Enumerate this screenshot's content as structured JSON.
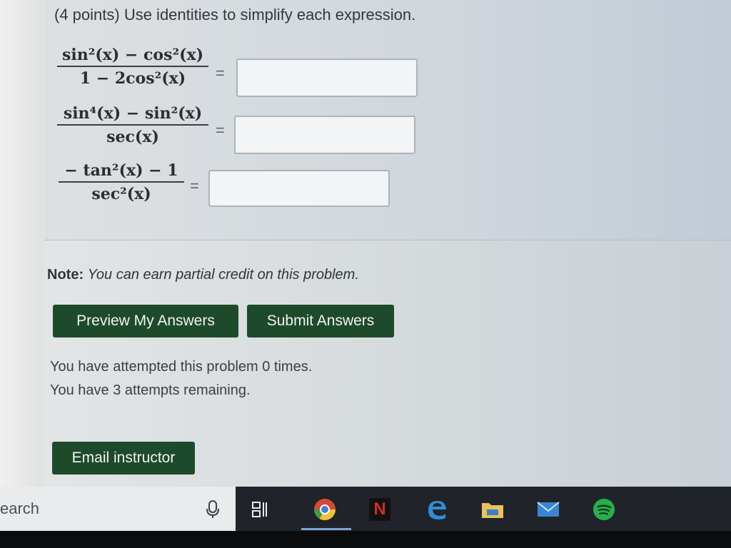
{
  "problem": {
    "title": "(4 points) Use identities to simplify each expression.",
    "expressions": [
      {
        "numerator": "sin²(x) − cos²(x)",
        "denominator": "1 − 2cos²(x)",
        "equals": "=",
        "answer": ""
      },
      {
        "numerator": "sin⁴(x) − sin²(x)",
        "denominator": "sec(x)",
        "equals": "=",
        "answer": ""
      },
      {
        "numerator": "− tan²(x) − 1",
        "denominator": "sec²(x)",
        "equals": "=",
        "answer": ""
      }
    ]
  },
  "note": {
    "label": "Note:",
    "text": "You can earn partial credit on this problem."
  },
  "buttons": {
    "preview": "Preview My Answers",
    "submit": "Submit Answers",
    "email": "Email instructor"
  },
  "status": {
    "attempted": "You have attempted this problem 0 times.",
    "remaining": "You have 3 attempts remaining."
  },
  "taskbar": {
    "search_text": "earch",
    "icons": [
      "microphone-icon",
      "task-view-icon",
      "chrome-icon",
      "netflix-icon",
      "edge-icon",
      "file-explorer-icon",
      "mail-icon",
      "spotify-icon"
    ],
    "netflix_letter": "N"
  },
  "colors": {
    "button_bg": "#1e4a2c",
    "taskbar_bg": "#20242a"
  }
}
